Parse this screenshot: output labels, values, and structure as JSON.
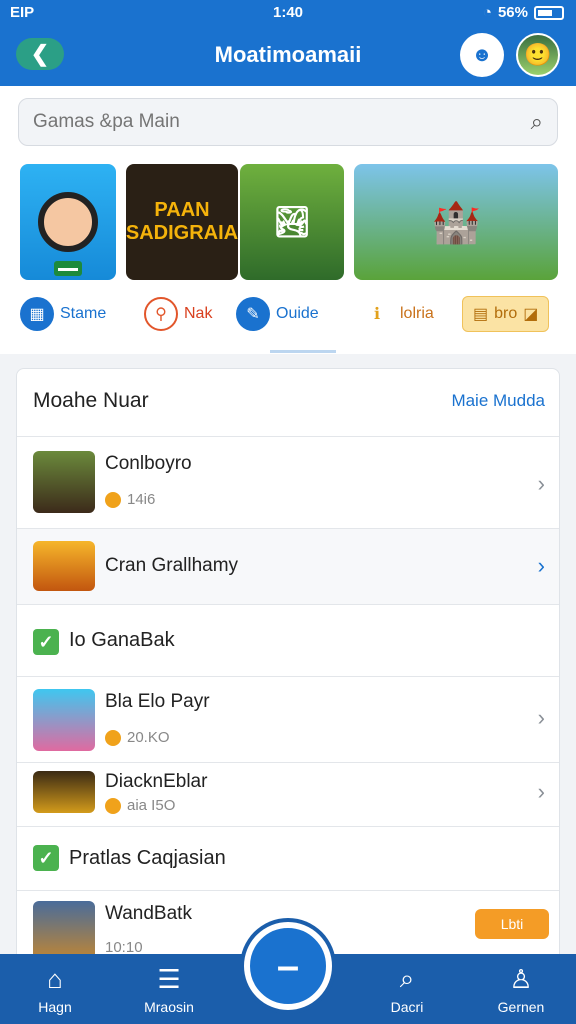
{
  "status": {
    "left": "EIP",
    "time": "1:40",
    "battery": "56%"
  },
  "header": {
    "title": "Moatimoamaii"
  },
  "search": {
    "placeholder": "Gamas &pa Main"
  },
  "banners": [
    {
      "label": ""
    },
    {
      "label": "PAAN SADIGRAIA"
    },
    {
      "label": ""
    },
    {
      "label": ""
    }
  ],
  "categories": [
    {
      "label": "Stame",
      "icon": "grid-icon"
    },
    {
      "label": "Nak",
      "icon": "pin-icon"
    },
    {
      "label": "Ouide",
      "icon": "pen-icon"
    },
    {
      "label": "lolria",
      "icon": "info-icon"
    },
    {
      "label": "bro",
      "icon": "tag-icon"
    }
  ],
  "section": {
    "title": "Moahe Nuar",
    "link": "Maie Mudda",
    "items": [
      {
        "name": "Conlboyro",
        "meta": "14i6"
      },
      {
        "name": "Cran Grallhamy",
        "meta": ""
      }
    ]
  },
  "section2": {
    "title": "Io GanaBak",
    "items": [
      {
        "name": "Bla Elo Payr",
        "meta": "20.KO"
      },
      {
        "name": "DiacknEblar",
        "meta": "aia I5O"
      }
    ]
  },
  "section3": {
    "title": "Pratlas Caqjasian",
    "items": [
      {
        "name": "WandBatk",
        "meta": "10:10",
        "button": "Lbti"
      }
    ]
  },
  "nav": [
    {
      "label": "Hagn",
      "icon": "home-icon"
    },
    {
      "label": "Mraosin",
      "icon": "list-icon"
    },
    {
      "label": "Dacri",
      "icon": "search-icon"
    },
    {
      "label": "Gernen",
      "icon": "profile-icon"
    }
  ],
  "colors": {
    "primary": "#1a72cf",
    "nav": "#1b5eab",
    "accent": "#f49c26",
    "check": "#4bb24f"
  }
}
